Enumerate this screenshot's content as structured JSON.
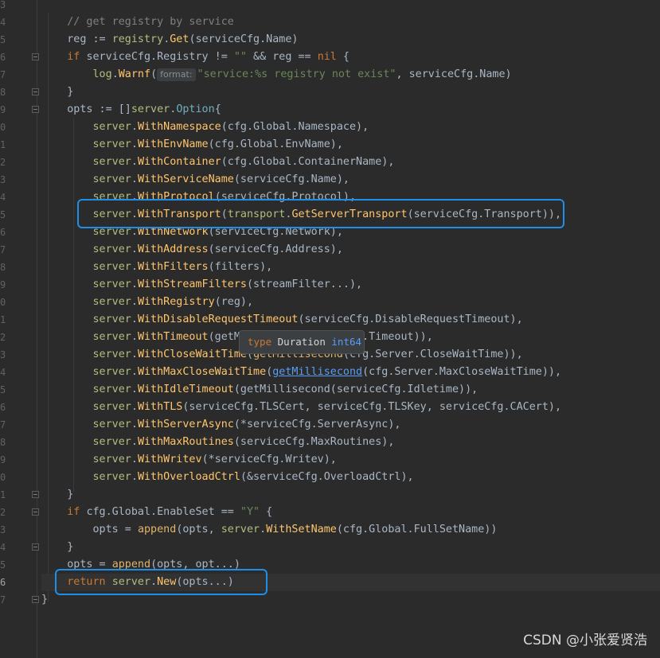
{
  "editor": {
    "line_numbers": [
      "3",
      "4",
      "5",
      "6",
      "7",
      "8",
      "9",
      "0",
      "1",
      "2",
      "3",
      "4",
      "5",
      "6",
      "7",
      "8",
      "9",
      "0",
      "1",
      "2",
      "3",
      "4",
      "5",
      "6",
      "7",
      "8",
      "9",
      "0",
      "1",
      "2",
      "3",
      "4",
      "5",
      "6",
      "7"
    ],
    "current_line_number": "6"
  },
  "code": {
    "l04": "// get registry by service",
    "l05_var": "reg := ",
    "l05_pkg": "registry",
    "l05_fn": "Get",
    "l05_rest": "(serviceCfg.Name)",
    "l06_kw": "if ",
    "l06_a": "serviceCfg.Registry != ",
    "l06_str": "\"\"",
    "l06_b": " && reg == ",
    "l06_nil": "nil",
    "l06_c": " {",
    "l07_pkg": "log",
    "l07_fn": "Warnf",
    "l07_hint": "format:",
    "l07_str": "\"service:%s registry not exist\"",
    "l07_rest": ", serviceCfg.Name)",
    "l08": "}",
    "l09_a": "opts := []",
    "l09_pkg": "server",
    "l09_typ": "Option",
    "l09_b": "{",
    "opt_pkg": "server",
    "opts": [
      {
        "fn": "WithNamespace",
        "args": "(cfg.Global.Namespace),"
      },
      {
        "fn": "WithEnvName",
        "args": "(cfg.Global.EnvName),"
      },
      {
        "fn": "WithContainer",
        "args": "(cfg.Global.ContainerName),"
      },
      {
        "fn": "WithServiceName",
        "args": "(serviceCfg.Name),"
      },
      {
        "fn": "WithProtocol",
        "args": "(serviceCfg.Protocol),"
      }
    ],
    "transport_fn": "WithTransport",
    "transport_open": "(",
    "transport_pkg": "transport",
    "transport_inner": "GetServerTransport",
    "transport_rest": "(serviceCfg.Transport)),",
    "opts2": [
      {
        "fn": "WithNetwork",
        "args": "(serviceCfg.Network),"
      },
      {
        "fn": "WithAddress",
        "args": "(serviceCfg.Address),"
      },
      {
        "fn": "WithFilters",
        "args": "(filters),"
      },
      {
        "fn": "WithStreamFilters",
        "args": "(streamFilter...),"
      },
      {
        "fn": "WithRegistry",
        "args": "(reg),"
      },
      {
        "fn": "WithDisableRequestTimeout",
        "args": "(serviceCfg.DisableRequestTimeout),"
      }
    ],
    "timeout_fn": "WithTimeout",
    "timeout_a": "(getM",
    "timeout_b": "g.Timeout)),",
    "closewait_fn": "WithCloseWaitTime",
    "closewait_a": "(",
    "closewait_hidden": "getMillisecond",
    "closewait_b": "(cfg.Server.CloseWaitTime)),",
    "maxclose_fn": "WithMaxCloseWaitTime",
    "maxclose_a": "(",
    "maxclose_link": "getMillisecond",
    "maxclose_b": "(cfg.Server.MaxCloseWaitTime)),",
    "opts3": [
      {
        "fn": "WithIdleTimeout",
        "args": "(getMillisecond(serviceCfg.Idletime)),"
      },
      {
        "fn": "WithTLS",
        "args": "(serviceCfg.TLSCert, serviceCfg.TLSKey, serviceCfg.CACert),"
      },
      {
        "fn": "WithServerAsync",
        "args": "(*serviceCfg.ServerAsync),"
      },
      {
        "fn": "WithMaxRoutines",
        "args": "(serviceCfg.MaxRoutines),"
      },
      {
        "fn": "WithWritev",
        "args": "(*serviceCfg.Writev),"
      },
      {
        "fn": "WithOverloadCtrl",
        "args": "(&serviceCfg.OverloadCtrl),"
      }
    ],
    "l31": "}",
    "l32_kw": "if ",
    "l32_a": "cfg.Global.EnableSet == ",
    "l32_str": "\"Y\"",
    "l32_b": " {",
    "l33_a": "opts = ",
    "l33_fn": "append",
    "l33_b": "(opts, ",
    "l33_pkg": "server",
    "l33_fn2": "WithSetName",
    "l33_c": "(cfg.Global.FullSetName))",
    "l34": "}",
    "l35_a": "opts = ",
    "l35_fn": "append",
    "l35_b": "(opts, opt...)",
    "l36_kw": "return ",
    "l36_pkg": "server",
    "l36_fn": "New",
    "l36_b": "(opts...)",
    "l37": "}"
  },
  "tooltip": {
    "kw": "type",
    "name": "Duration",
    "base": "int64"
  },
  "watermark": "CSDN @小张爱贤浩",
  "colors": {
    "background": "#2b2b2b",
    "keyword": "#cc7832",
    "function": "#ffc66d",
    "package": "#afbf7e",
    "string": "#6a8759",
    "highlight_box": "#1e8ee8"
  }
}
